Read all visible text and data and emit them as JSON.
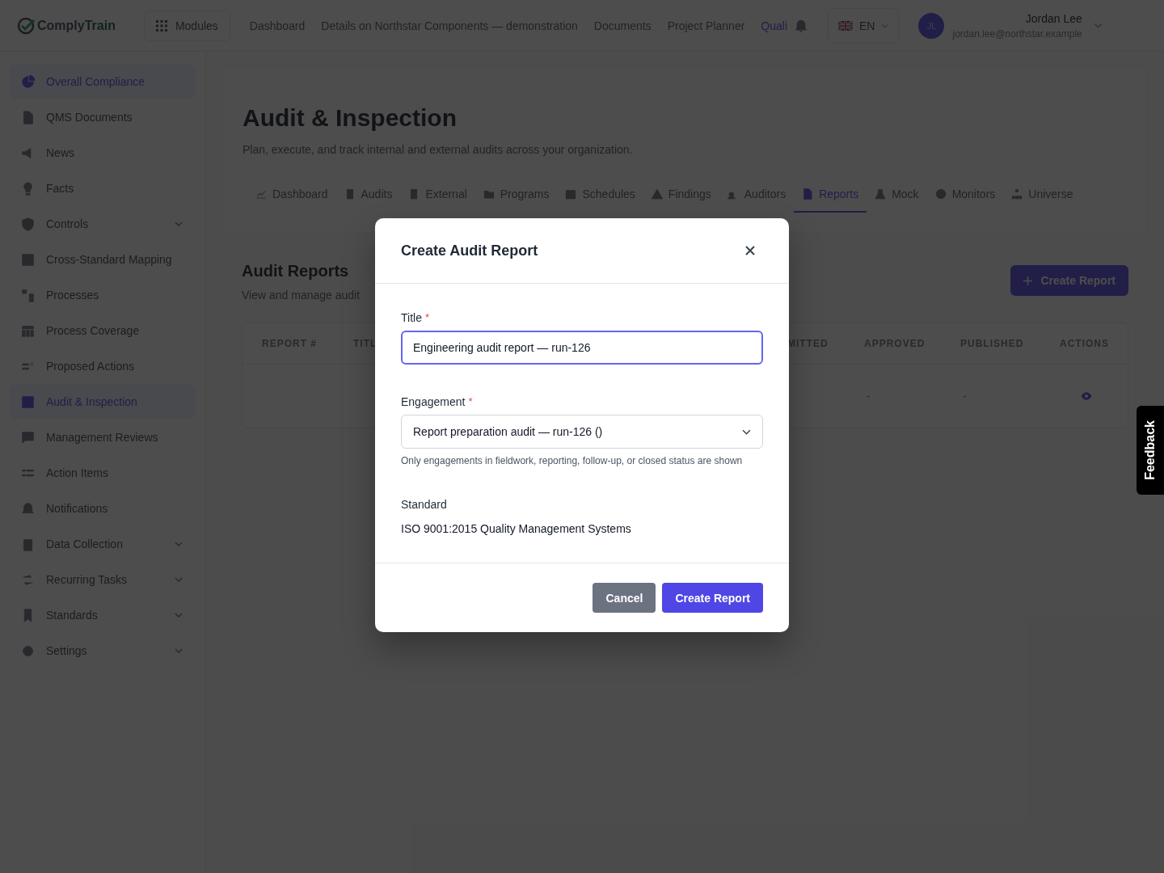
{
  "header": {
    "logo": {
      "first": "Comply",
      "second": "Train"
    },
    "modules_button": "Modules",
    "nav": [
      {
        "label": "Dashboard",
        "selected": false
      },
      {
        "label": "Details on Northstar Components — demonstration",
        "selected": false
      },
      {
        "label": "Documents",
        "selected": false
      },
      {
        "label": "Project Planner",
        "selected": false
      },
      {
        "label": "Quali",
        "selected": true
      }
    ],
    "language": "EN",
    "user": {
      "initials": "JL",
      "name": "Jordan Lee",
      "email": "jordan.lee@northstar.example"
    }
  },
  "sidebar": {
    "items": [
      {
        "label": "Overall Compliance",
        "selected": true,
        "expandable": false
      },
      {
        "label": "QMS Documents",
        "selected": false,
        "expandable": false
      },
      {
        "label": "News",
        "selected": false,
        "expandable": false
      },
      {
        "label": "Facts",
        "selected": false,
        "expandable": false
      },
      {
        "label": "Controls",
        "selected": false,
        "expandable": true
      },
      {
        "label": "Cross-Standard Mapping",
        "selected": false,
        "expandable": false
      },
      {
        "label": "Processes",
        "selected": false,
        "expandable": false
      },
      {
        "label": "Process Coverage",
        "selected": false,
        "expandable": false
      },
      {
        "label": "Proposed Actions",
        "selected": false,
        "expandable": false
      },
      {
        "label": "Audit & Inspection",
        "selected": true,
        "expandable": false
      },
      {
        "label": "Management Reviews",
        "selected": false,
        "expandable": false
      },
      {
        "label": "Action Items",
        "selected": false,
        "expandable": false
      },
      {
        "label": "Notifications",
        "selected": false,
        "expandable": false
      },
      {
        "label": "Data Collection",
        "selected": false,
        "expandable": true
      },
      {
        "label": "Recurring Tasks",
        "selected": false,
        "expandable": true
      },
      {
        "label": "Standards",
        "selected": false,
        "expandable": true
      },
      {
        "label": "Settings",
        "selected": false,
        "expandable": true
      }
    ]
  },
  "page": {
    "title": "Audit & Inspection",
    "subtitle": "Plan, execute, and track internal and external audits across your organization.",
    "tabs": [
      {
        "label": "Dashboard",
        "selected": false
      },
      {
        "label": "Audits",
        "selected": false
      },
      {
        "label": "External",
        "selected": false
      },
      {
        "label": "Programs",
        "selected": false
      },
      {
        "label": "Schedules",
        "selected": false
      },
      {
        "label": "Findings",
        "selected": false
      },
      {
        "label": "Auditors",
        "selected": false
      },
      {
        "label": "Reports",
        "selected": true
      },
      {
        "label": "Mock",
        "selected": false
      },
      {
        "label": "Monitors",
        "selected": false
      },
      {
        "label": "Universe",
        "selected": false
      }
    ],
    "section": {
      "title": "Audit Reports",
      "subtitle": "View and manage audit",
      "create_button": "Create Report",
      "table": {
        "columns": [
          "REPORT #",
          "TITL",
          "MITTED",
          "APPROVED",
          "PUBLISHED",
          "ACTIONS"
        ],
        "rows": [
          {
            "approved": "-",
            "published": "-"
          }
        ]
      }
    }
  },
  "modal": {
    "title": "Create Audit Report",
    "title_field": {
      "label": "Title",
      "required_mark": "*",
      "value": "Engineering audit report — run-126"
    },
    "engagement_field": {
      "label": "Engagement",
      "required_mark": "*",
      "value": "Report preparation audit — run-126 ()",
      "hint": "Only engagements in fieldwork, reporting, follow-up, or closed status are shown"
    },
    "standard": {
      "label": "Standard",
      "value": "ISO 9001:2015 Quality Management Systems"
    },
    "cancel_button": "Cancel",
    "submit_button": "Create Report"
  },
  "feedback_tab": "Feedback"
}
